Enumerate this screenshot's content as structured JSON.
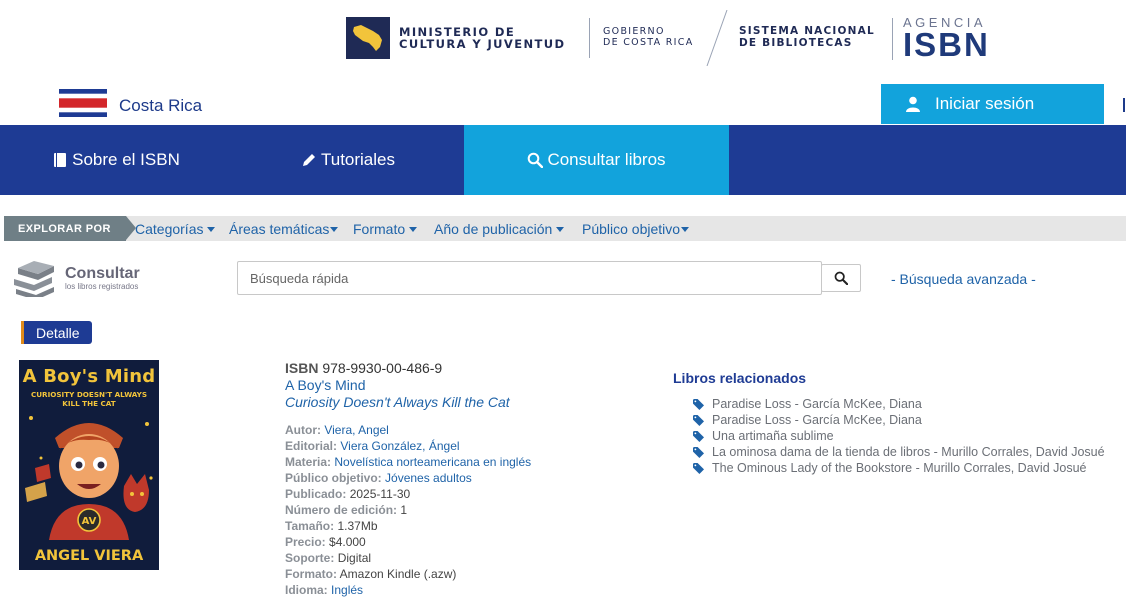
{
  "header": {
    "mcj_line1": "MINISTERIO DE",
    "mcj_line2": "CULTURA Y JUVENTUD",
    "gob_line1": "GOBIERNO",
    "gob_line2": "DE COSTA RICA",
    "sinabi_line1": "SISTEMA NACIONAL",
    "sinabi_line2": "DE BIBLIOTECAS",
    "agency_small": "AGENCIA",
    "agency_big": "ISBN"
  },
  "country": {
    "name": "Costa Rica",
    "login_label": "Iniciar sesión"
  },
  "nav": {
    "items": [
      {
        "label": "Sobre el ISBN",
        "icon": "book-icon"
      },
      {
        "label": "Tutoriales",
        "icon": "pencil-icon"
      },
      {
        "label": "Consultar libros",
        "icon": "search-icon",
        "active": true
      }
    ]
  },
  "explore": {
    "tag": "EXPLORAR POR",
    "items": [
      "Categorías",
      "Áreas temáticas",
      "Formato",
      "Año de publicación",
      "Público objetivo"
    ]
  },
  "search": {
    "logo_title": "Consultar",
    "logo_sub": "los libros registrados",
    "placeholder": "Búsqueda rápida",
    "advanced": "- Búsqueda avanzada -"
  },
  "detail": {
    "tag": "Detalle",
    "cover": {
      "title": "A Boy's Mind",
      "subtitle_line1": "CURIOSITY DOESN'T ALWAYS",
      "subtitle_line2": "KILL THE CAT",
      "author": "ANGEL VIERA",
      "badge": "AV"
    },
    "isbn_label": "ISBN",
    "isbn": "978-9930-00-486-9",
    "title": "A Boy's Mind",
    "subtitle": "Curiosity Doesn't Always Kill the Cat",
    "fields": {
      "autor_label": "Autor:",
      "autor": "Viera, Angel",
      "editorial_label": "Editorial:",
      "editorial": "Viera González,  Ángel",
      "materia_label": "Materia:",
      "materia": "Novelística norteamericana en inglés",
      "publico_label": "Público objetivo:",
      "publico": "Jóvenes adultos",
      "publicado_label": "Publicado:",
      "publicado": "2025-11-30",
      "edicion_label": "Número de edición:",
      "edicion": "1",
      "tamano_label": "Tamaño:",
      "tamano": "1.37Mb",
      "precio_label": "Precio:",
      "precio": "$4.000",
      "soporte_label": "Soporte:",
      "soporte": "Digital",
      "formato_label": "Formato:",
      "formato": "Amazon Kindle (.azw)",
      "idioma_label": "Idioma:",
      "idioma": "Inglés"
    }
  },
  "related": {
    "title": "Libros relacionados",
    "items": [
      "Paradise Loss - García McKee, Diana",
      "Paradise Loss - García McKee, Diana",
      "Una artimaña sublime",
      "La ominosa dama de la tienda de libros - Murillo Corrales, David Josué",
      "The Ominous Lady of the Bookstore - Murillo Corrales, David Josué"
    ]
  },
  "colors": {
    "nav_blue": "#1e3b94",
    "accent_cyan": "#12a3dc",
    "link_blue": "#1f63a8"
  }
}
